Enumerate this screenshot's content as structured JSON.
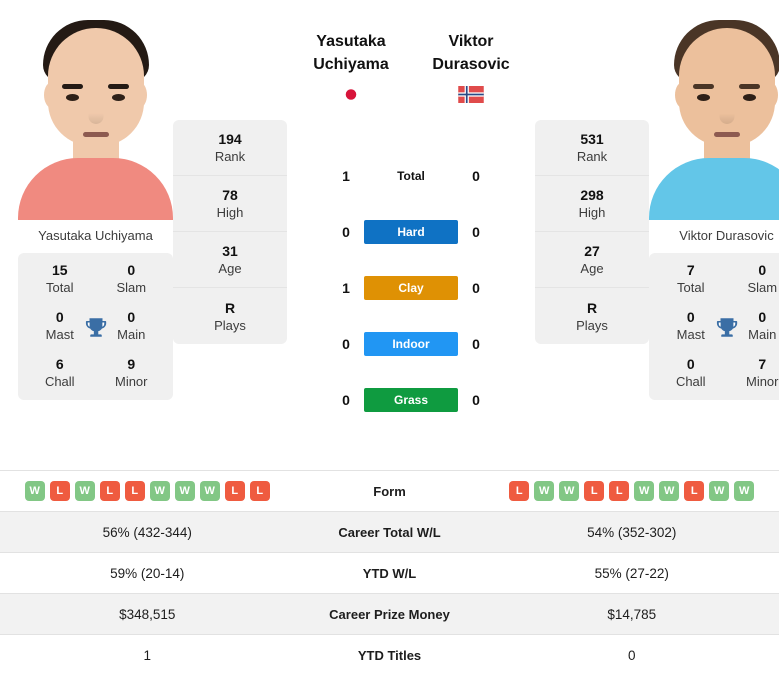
{
  "players": {
    "left": {
      "first_name": "Yasutaka",
      "last_name": "Uchiyama",
      "full_name": "Yasutaka Uchiyama",
      "country_flag": "japan-flag",
      "shirt_color": "#f08a80",
      "hair_color": "#241a14",
      "skin_color": "#f0c9ab",
      "stats": {
        "rank": "194",
        "rank_label": "Rank",
        "high": "78",
        "high_label": "High",
        "age": "31",
        "age_label": "Age",
        "plays": "R",
        "plays_label": "Plays"
      },
      "titles": {
        "total": "15",
        "total_label": "Total",
        "slam": "0",
        "slam_label": "Slam",
        "mast": "0",
        "mast_label": "Mast",
        "main": "0",
        "main_label": "Main",
        "chall": "6",
        "chall_label": "Chall",
        "minor": "9",
        "minor_label": "Minor"
      },
      "form": [
        "W",
        "L",
        "W",
        "L",
        "L",
        "W",
        "W",
        "W",
        "L",
        "L"
      ],
      "career_total_wl": "56% (432-344)",
      "ytd_wl": "59% (20-14)",
      "career_prize_money": "$348,515",
      "ytd_titles": "1"
    },
    "right": {
      "first_name": "Viktor",
      "last_name": "Durasovic",
      "full_name": "Viktor Durasovic",
      "country_flag": "norway-flag",
      "shirt_color": "#63c6e8",
      "hair_color": "#4a3526",
      "skin_color": "#ecc09c",
      "stats": {
        "rank": "531",
        "rank_label": "Rank",
        "high": "298",
        "high_label": "High",
        "age": "27",
        "age_label": "Age",
        "plays": "R",
        "plays_label": "Plays"
      },
      "titles": {
        "total": "7",
        "total_label": "Total",
        "slam": "0",
        "slam_label": "Slam",
        "mast": "0",
        "mast_label": "Mast",
        "main": "0",
        "main_label": "Main",
        "chall": "0",
        "chall_label": "Chall",
        "minor": "7",
        "minor_label": "Minor"
      },
      "form": [
        "L",
        "W",
        "W",
        "L",
        "L",
        "W",
        "W",
        "L",
        "W",
        "W"
      ],
      "career_total_wl": "54% (352-302)",
      "ytd_wl": "55% (27-22)",
      "career_prize_money": "$14,785",
      "ytd_titles": "0"
    }
  },
  "head_to_head": [
    {
      "label": "Total",
      "left": "1",
      "right": "0",
      "type": "plain",
      "color": ""
    },
    {
      "label": "Hard",
      "left": "0",
      "right": "0",
      "type": "badge",
      "color": "#0f72c4"
    },
    {
      "label": "Clay",
      "left": "1",
      "right": "0",
      "type": "badge",
      "color": "#df9104"
    },
    {
      "label": "Indoor",
      "left": "0",
      "right": "0",
      "type": "badge",
      "color": "#2196f3"
    },
    {
      "label": "Grass",
      "left": "0",
      "right": "0",
      "type": "badge",
      "color": "#0f9b40"
    }
  ],
  "table_rows": [
    {
      "label": "Form",
      "key": "form",
      "kind": "chips"
    },
    {
      "label": "Career Total W/L",
      "key": "career_total_wl",
      "kind": "text"
    },
    {
      "label": "YTD W/L",
      "key": "ytd_wl",
      "kind": "text"
    },
    {
      "label": "Career Prize Money",
      "key": "career_prize_money",
      "kind": "text"
    },
    {
      "label": "YTD Titles",
      "key": "ytd_titles",
      "kind": "text"
    }
  ],
  "colors": {
    "form_win": "#82c785",
    "form_loss": "#ef5b40",
    "card_bg": "#f0f0f0",
    "alt_row_bg": "#f2f2f2",
    "trophy": "#3a6ea5"
  }
}
